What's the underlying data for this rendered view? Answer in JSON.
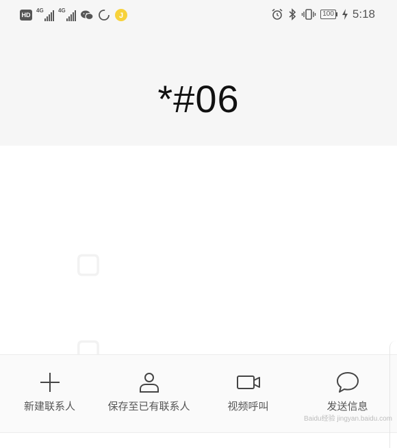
{
  "status_bar": {
    "hd_label": "HD",
    "signal_1_label": "4G",
    "signal_2_label": "4G",
    "battery_level": "100",
    "time": "5:18",
    "icons_left": [
      "hd-icon",
      "signal-4g-icon",
      "signal-4g-icon",
      "wechat-icon",
      "sync-icon",
      "app-notification-icon"
    ],
    "icons_right": [
      "alarm-icon",
      "bluetooth-icon",
      "vibrate-icon",
      "battery-icon",
      "charging-icon"
    ]
  },
  "dialer": {
    "dialed_number": "*#06"
  },
  "actions": [
    {
      "label": "新建联系人",
      "icon": "plus-icon"
    },
    {
      "label": "保存至已有联系人",
      "icon": "person-icon"
    },
    {
      "label": "视频呼叫",
      "icon": "video-camera-icon"
    },
    {
      "label": "发送信息",
      "icon": "chat-bubble-icon"
    }
  ],
  "watermark": {
    "text": "Baidu经验 jingyan.baidu.com"
  },
  "colors": {
    "top_panel_bg": "#f6f6f6",
    "action_bar_bg": "#fafafa",
    "icon_color": "#555555",
    "notification_yellow": "#f7d23b"
  }
}
